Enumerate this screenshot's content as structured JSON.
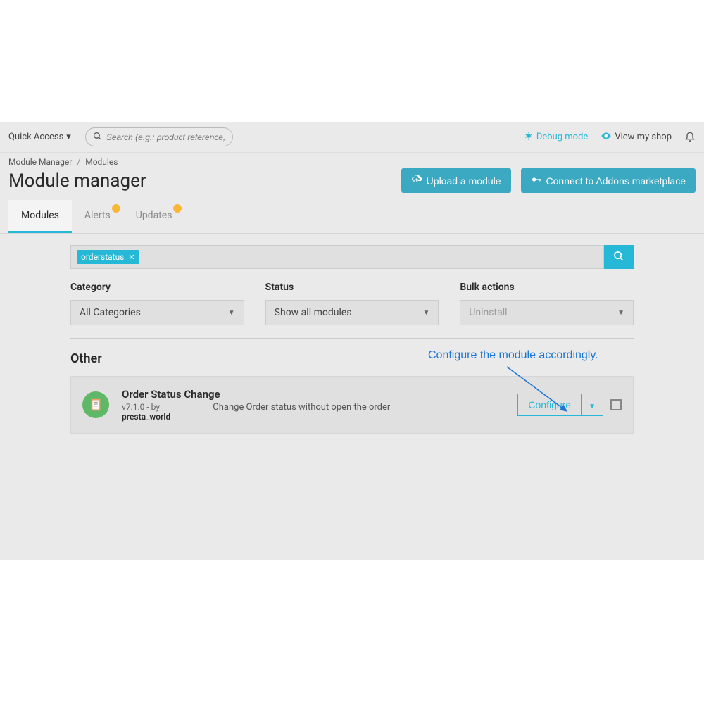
{
  "topbar": {
    "quick_access": "Quick Access",
    "search_placeholder": "Search (e.g.: product reference, custome",
    "debug": "Debug mode",
    "view_shop": "View my shop"
  },
  "breadcrumb": {
    "parent": "Module Manager",
    "current": "Modules"
  },
  "page_title": "Module manager",
  "buttons": {
    "upload": "Upload a module",
    "connect": "Connect to Addons marketplace"
  },
  "tabs": {
    "modules": "Modules",
    "alerts": "Alerts",
    "updates": "Updates"
  },
  "search_tag": "orderstatus",
  "filters": {
    "category_label": "Category",
    "category_value": "All Categories",
    "status_label": "Status",
    "status_value": "Show all modules",
    "bulk_label": "Bulk actions",
    "bulk_value": "Uninstall"
  },
  "section": "Other",
  "module": {
    "name": "Order Status Change",
    "version": "v7.1.0",
    "by_label": " - by",
    "author": "presta_world",
    "description": "Change Order status without open the order",
    "configure": "Configure"
  },
  "annotation": "Configure the module accordingly."
}
